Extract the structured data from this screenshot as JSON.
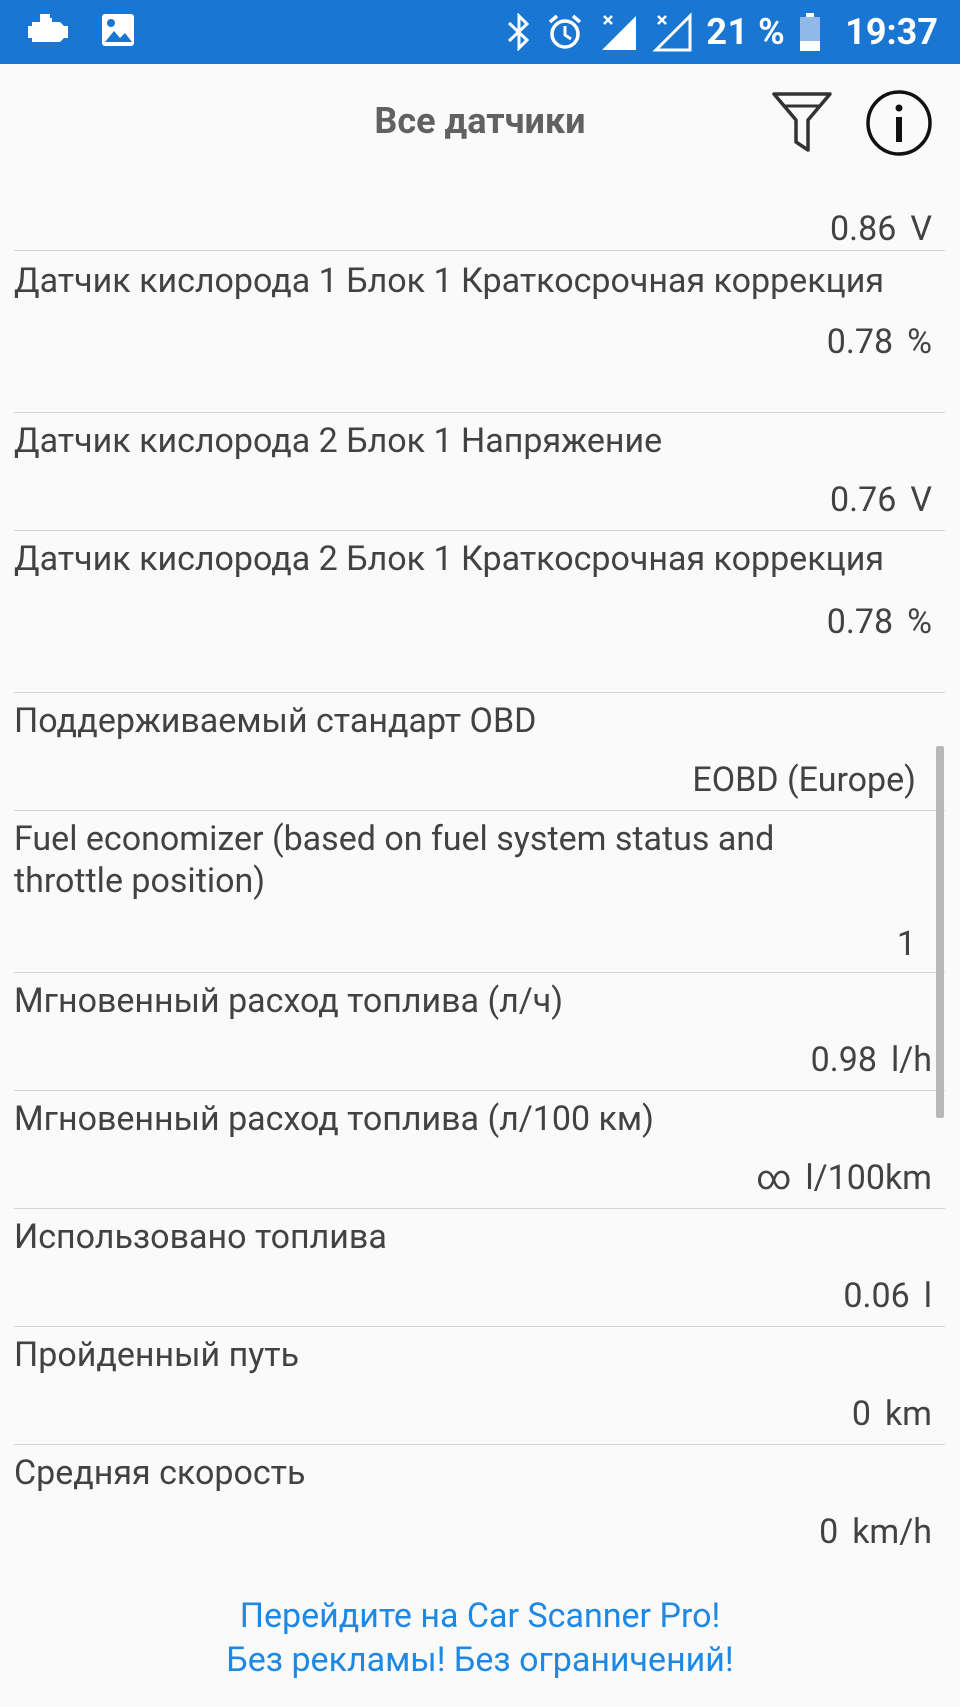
{
  "status_bar": {
    "battery_percent": "21 %",
    "time": "19:37",
    "icons": [
      "check-engine-icon",
      "image-icon",
      "bluetooth-icon",
      "alarm-icon",
      "signal-icon",
      "signal-icon",
      "battery-icon"
    ]
  },
  "header": {
    "title": "Все датчики",
    "filter_icon": "filter-icon",
    "info_icon": "info-icon"
  },
  "rows": [
    {
      "label": "",
      "value": "0.86",
      "unit": "V"
    },
    {
      "label": "Датчик кислорода 1 Блок 1 Краткосрочная коррекция",
      "value": "0.78",
      "unit": "%"
    },
    {
      "label": "Датчик кислорода 2 Блок 1 Напряжение",
      "value": "0.76",
      "unit": "V"
    },
    {
      "label": "Датчик кислорода 2 Блок 1 Краткосрочная коррекция",
      "value": "0.78",
      "unit": "%"
    },
    {
      "label": "Поддерживаемый стандарт OBD",
      "value": "EOBD (Europe)",
      "unit": ""
    },
    {
      "label": "Fuel economizer (based on fuel system status and throttle position)",
      "value": "1",
      "unit": ""
    },
    {
      "label": "Мгновенный расход топлива (л/ч)",
      "value": "0.98",
      "unit": "l/h"
    },
    {
      "label": "Мгновенный расход топлива (л/100 км)",
      "value": "∞",
      "unit": "l/100km"
    },
    {
      "label": "Использовано топлива",
      "value": "0.06",
      "unit": "l"
    },
    {
      "label": "Пройденный путь",
      "value": "0",
      "unit": "km"
    },
    {
      "label": "Средняя скорость",
      "value": "0",
      "unit": "km/h"
    }
  ],
  "promo": {
    "line1": "Перейдите на Car Scanner Pro!",
    "line2": "Без рекламы! Без ограничений!"
  },
  "colors": {
    "status_bar": "#1976d2",
    "background": "#fafafa",
    "text": "#424242",
    "promo": "#1e88e5"
  }
}
